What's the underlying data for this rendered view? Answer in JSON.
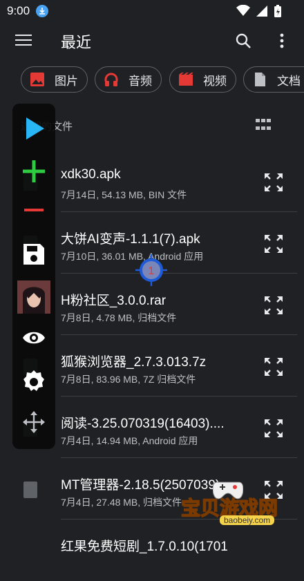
{
  "status": {
    "time": "9:00"
  },
  "appbar": {
    "title": "最近"
  },
  "chips": [
    {
      "label": "图片",
      "icon": "image-icon",
      "color": "#e53935"
    },
    {
      "label": "音频",
      "icon": "headphones-icon",
      "color": "#e53935"
    },
    {
      "label": "视频",
      "icon": "video-icon",
      "color": "#e53935"
    },
    {
      "label": "文档",
      "icon": "document-icon",
      "color": "#bdc1c6"
    }
  ],
  "section": {
    "label": "近期的文件"
  },
  "files": [
    {
      "name": "xdk30.apk",
      "meta": "7月14日, 54.13 MB, BIN 文件"
    },
    {
      "name": "大饼AI变声-1.1.1(7).apk",
      "meta": "7月10日, 36.01 MB, Android 应用"
    },
    {
      "name": "H粉社区_3.0.0.rar",
      "meta": "7月8日, 4.78 MB, 归档文件"
    },
    {
      "name": "狐猴浏览器_2.7.3.013.7z",
      "meta": "7月8日, 83.96 MB, 7Z 归档文件"
    },
    {
      "name": "阅读-3.25.070319(16403)....",
      "meta": "7月4日, 14.94 MB, Android 应用"
    },
    {
      "name": "MT管理器-2.18.5(2507039)...",
      "meta": "7月4日, 27.48 MB, 归档文件"
    },
    {
      "name": "红果免费短剧_1.7.0.10(1701",
      "meta": ""
    }
  ],
  "floating_bar": {
    "items": [
      "play-icon",
      "add-icon",
      "remove-icon",
      "save-icon",
      "avatar",
      "eye-icon",
      "settings-icon",
      "move-icon"
    ],
    "play_color": "#29b6f6",
    "add_color": "#2ecc40",
    "remove_color": "#e53935"
  },
  "crosshair": {
    "number": "1"
  },
  "watermark": {
    "text": "宝贝游戏网",
    "url": "baobeiy.com"
  }
}
